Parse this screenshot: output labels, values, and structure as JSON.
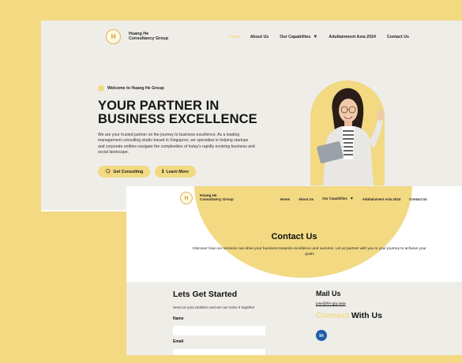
{
  "hero_page": {
    "brand": {
      "line1": "Huang He",
      "line2": "Consultancy Group",
      "logo_glyph": "H"
    },
    "nav": {
      "home": "Home",
      "about": "About Us",
      "capabilities": "Our Capabilites",
      "adult": "Adultainment Asia 2024",
      "contact": "Contact Us"
    },
    "welcome": "Welcome to Huang He Group",
    "title_line1": "YOUR PARTNER IN",
    "title_line2": "BUSINESS EXCELLENCE",
    "description": "We are your trusted partner on the journey to business excellence. As a leading management consulting studio based in Singapore, we specialize in helping startups and corporate entities navigate the complexities of today's rapidly evolving business and social landscape.",
    "btn_consult": "Get Consulting",
    "btn_learn": "Learn More"
  },
  "contact_page": {
    "brand": {
      "line1": "Huang He",
      "line2": "Consultancy Group",
      "logo_glyph": "H"
    },
    "nav": {
      "home": "Home",
      "about": "About Us",
      "capabilities": "Our Capabilites",
      "adult": "Adultainment Asia 2024",
      "contact": "Contact Us"
    },
    "title": "Contact Us",
    "description": "Discover how our services can drive your business towards excellence and success. Let us partner with you in your journey to achieve your goals",
    "form_title": "Lets Get Started",
    "form_sub": "Send us your problem and we can solve it together",
    "name_label": "Name",
    "email_label": "Email",
    "mail_title": "Mail Us",
    "mail_address": "jose@hh-grp.asia",
    "connect_highlight": "Connect",
    "connect_rest": "With Us",
    "linkedin_glyph": "in"
  },
  "colors": {
    "accent": "#f2d982",
    "background": "#efede8",
    "text": "#151515",
    "linkedin": "#1f5fa8"
  },
  "icons": [
    "logo-icon",
    "chevron-down-icon",
    "chat-icon",
    "info-icon",
    "linkedin-icon"
  ]
}
